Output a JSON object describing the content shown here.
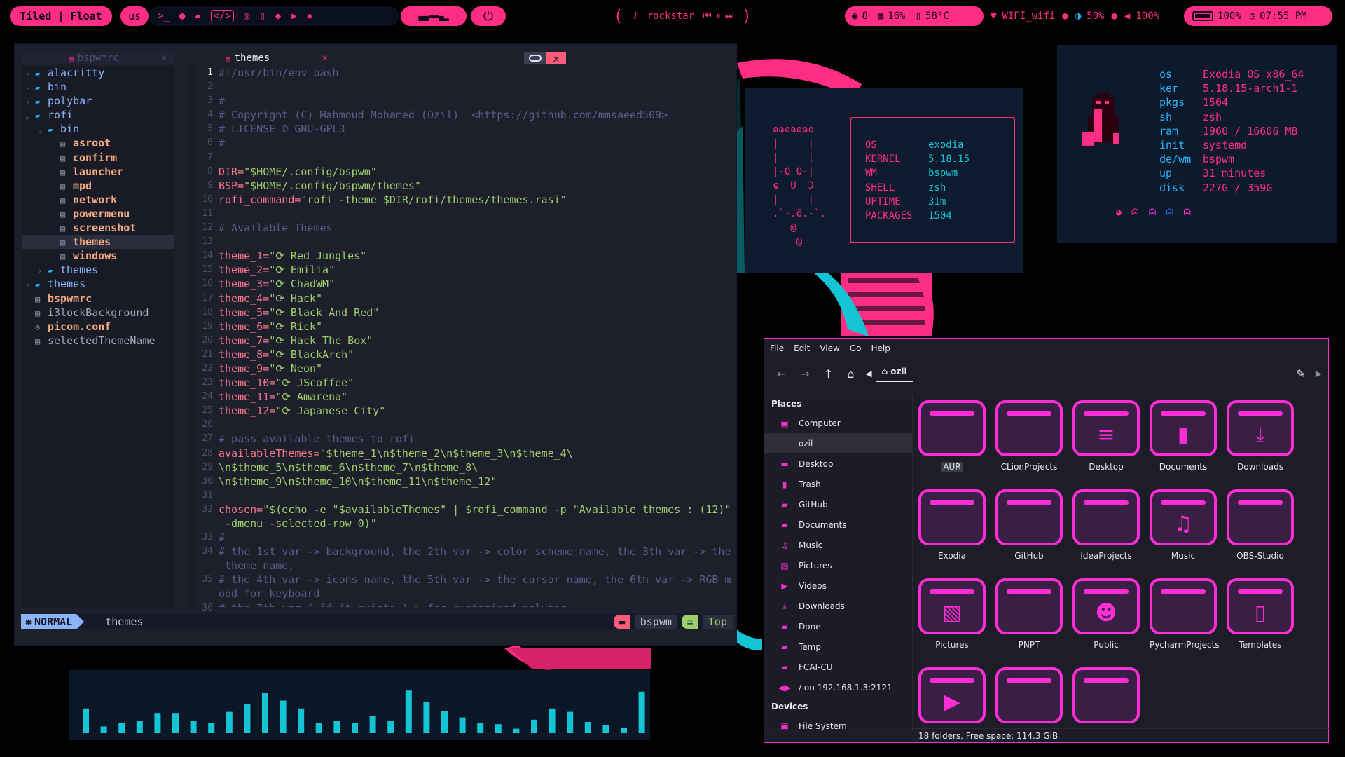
{
  "topbar": {
    "layout": "Tiled | Float",
    "keyboard": "us",
    "workspaces_glyph": "▄▄▬▬▄▂",
    "media_note": "♪",
    "media_title": "rockstar",
    "updates": "8",
    "cpu": "16%",
    "temp": "58°C",
    "wifi": "WIFI_wifi",
    "brightness": "50%",
    "volume": "100%",
    "battery": "100%",
    "time": "07:55 PM"
  },
  "editor": {
    "inactive_tab": "bspwmrc",
    "active_tab": "themes",
    "tree": [
      {
        "d": 0,
        "t": "alacritty",
        "k": "dir"
      },
      {
        "d": 0,
        "t": "bin",
        "k": "dir"
      },
      {
        "d": 0,
        "t": "polybar",
        "k": "dir"
      },
      {
        "d": 0,
        "t": "rofi",
        "k": "dir-open"
      },
      {
        "d": 1,
        "t": "bin",
        "k": "dir-open"
      },
      {
        "d": 2,
        "t": "asroot",
        "k": "file"
      },
      {
        "d": 2,
        "t": "confirm",
        "k": "file"
      },
      {
        "d": 2,
        "t": "launcher",
        "k": "file"
      },
      {
        "d": 2,
        "t": "mpd",
        "k": "file"
      },
      {
        "d": 2,
        "t": "network",
        "k": "file"
      },
      {
        "d": 2,
        "t": "powermenu",
        "k": "file"
      },
      {
        "d": 2,
        "t": "screenshot",
        "k": "file"
      },
      {
        "d": 2,
        "t": "themes",
        "k": "file-sel"
      },
      {
        "d": 2,
        "t": "windows",
        "k": "file"
      },
      {
        "d": 1,
        "t": "themes",
        "k": "dir"
      },
      {
        "d": 0,
        "t": "themes",
        "k": "dir"
      },
      {
        "d": 0,
        "t": "bspwmrc",
        "k": "file-hl"
      },
      {
        "d": 0,
        "t": "i3lockBackground",
        "k": "file-plain"
      },
      {
        "d": 0,
        "t": "picom.conf",
        "k": "gear"
      },
      {
        "d": 0,
        "t": "selectedThemeName",
        "k": "file-plain"
      }
    ],
    "lines": [
      {
        "n": "1",
        "t": "#!/usr/bin/env bash",
        "c": "cm"
      },
      {
        "n": "2",
        "t": "",
        "c": "cm"
      },
      {
        "n": "3",
        "t": "#",
        "c": "cm"
      },
      {
        "n": "4",
        "t": "# Copyright (C) Mahmoud Mohamed (Ozil)  <https://github.com/mmsaeed509>",
        "c": "cm"
      },
      {
        "n": "5",
        "t": "# LICENSE © GNU-GPL3",
        "c": "cm"
      },
      {
        "n": "6",
        "t": "#",
        "c": "cm"
      },
      {
        "n": "7",
        "t": "",
        "c": "cm"
      },
      {
        "n": "8",
        "t": "DIR=\"$HOME/.config/bspwm\"",
        "c": "as"
      },
      {
        "n": "9",
        "t": "BSP=\"$HOME/.config/bspwm/themes\"",
        "c": "as"
      },
      {
        "n": "10",
        "t": "rofi_command=\"rofi -theme $DIR/rofi/themes/themes.rasi\"",
        "c": "as"
      },
      {
        "n": "11",
        "t": "",
        "c": "cm"
      },
      {
        "n": "12",
        "t": "# Available Themes",
        "c": "cm"
      },
      {
        "n": "13",
        "t": "",
        "c": "cm"
      },
      {
        "n": "14",
        "t": "theme_1=\"⟳ Red Jungles\"",
        "c": "as"
      },
      {
        "n": "15",
        "t": "theme_2=\"⟳ Emilia\"",
        "c": "as"
      },
      {
        "n": "16",
        "t": "theme_3=\"⟳ ChadWM\"",
        "c": "as"
      },
      {
        "n": "17",
        "t": "theme_4=\"⟳ Hack\"",
        "c": "as"
      },
      {
        "n": "18",
        "t": "theme_5=\"⟳ Black And Red\"",
        "c": "as"
      },
      {
        "n": "19",
        "t": "theme_6=\"⟳ Rick\"",
        "c": "as"
      },
      {
        "n": "20",
        "t": "theme_7=\"⟳ Hack The Box\"",
        "c": "as"
      },
      {
        "n": "21",
        "t": "theme_8=\"⟳ BlackArch\"",
        "c": "as"
      },
      {
        "n": "22",
        "t": "theme_9=\"⟳ Neon\"",
        "c": "as"
      },
      {
        "n": "23",
        "t": "theme_10=\"⟳ JScoffee\"",
        "c": "as"
      },
      {
        "n": "24",
        "t": "theme_11=\"⟳ Amarena\"",
        "c": "as"
      },
      {
        "n": "25",
        "t": "theme_12=\"⟳ Japanese City\"",
        "c": "as"
      },
      {
        "n": "26",
        "t": "",
        "c": "cm"
      },
      {
        "n": "27",
        "t": "# pass available themes to rofi",
        "c": "cm"
      },
      {
        "n": "28",
        "t": "availableThemes=\"$theme_1\\n$theme_2\\n$theme_3\\n$theme_4\\",
        "c": "as"
      },
      {
        "n": "29",
        "t": "\\n$theme_5\\n$theme_6\\n$theme_7\\n$theme_8\\",
        "c": "as"
      },
      {
        "n": "30",
        "t": "\\n$theme_9\\n$theme_10\\n$theme_11\\n$theme_12\"",
        "c": "as"
      },
      {
        "n": "31",
        "t": "",
        "c": "cm"
      },
      {
        "n": "32",
        "t": "chosen=\"$(echo -e \"$availableThemes\" | $rofi_command -p \"Available themes : (12)\"",
        "c": "as"
      },
      {
        "n": "",
        "t": " -dmenu -selected-row 0)\"",
        "c": "as"
      },
      {
        "n": "33",
        "t": "#",
        "c": "cm"
      },
      {
        "n": "34",
        "t": "# the 1st var -> background, the 2th var -> color scheme name, the 3th var -> the",
        "c": "cm"
      },
      {
        "n": "",
        "t": " theme name,",
        "c": "cm"
      },
      {
        "n": "35",
        "t": "# the 4th var -> icons name, the 5th var -> the cursor name, the 6th var -> RGB m",
        "c": "cm"
      },
      {
        "n": "",
        "t": "ood for keyboard",
        "c": "cm"
      },
      {
        "n": "36",
        "t": "# the 7th var ( if it exists )-> for customized polybar",
        "c": "cm"
      }
    ],
    "status": {
      "mode": "NORMAL",
      "file": "themes",
      "ft": "bspwm",
      "pos": "Top"
    }
  },
  "fetch1": {
    "keys": [
      "OS",
      "KERNEL",
      "WM",
      "SHELL",
      "UPTIME",
      "PACKAGES"
    ],
    "values": [
      "exodia",
      "5.18.15",
      "bspwm",
      "zsh",
      "31m",
      "1504"
    ],
    "art": [
      "ɷɷɷɷɷɷɷ",
      "|     |",
      "|     |",
      "|-O O-|",
      "ɕ  U  Ɔ",
      "|     |",
      ".`-.ö.-`.",
      "   @",
      "    @"
    ]
  },
  "fetch2": {
    "keys": [
      "os",
      "ker",
      "pkgs",
      "sh",
      "ram",
      "init",
      "de/wm",
      "up",
      "disk"
    ],
    "values": [
      "Exodia OS x86_64",
      "5.18.15-arch1-1",
      "1504",
      "zsh",
      "1960 / 16606 MB",
      "systemd",
      "bspwm",
      "31 minutes",
      "227G / 359G"
    ]
  },
  "visualizer": {
    "levels": [
      0.44,
      0.12,
      0.18,
      0.22,
      0.36,
      0.36,
      0.22,
      0.18,
      0.38,
      0.52,
      0.72,
      0.58,
      0.44,
      0.18,
      0.22,
      0.18,
      0.3,
      0.22,
      0.76,
      0.56,
      0.4,
      0.28,
      0.18,
      0.16,
      0.08,
      0.24,
      0.44,
      0.38,
      0.2,
      0.14,
      0.1,
      0.74
    ]
  },
  "fm": {
    "menu": [
      "File",
      "Edit",
      "View",
      "Go",
      "Help"
    ],
    "location": "ozil",
    "places_title": "Places",
    "places": [
      "Computer",
      "ozil",
      "Desktop",
      "Trash",
      "GitHub",
      "Documents",
      "Music",
      "Pictures",
      "Videos",
      "Downloads",
      "Done",
      "Temp",
      "FCAI-CU",
      "/ on 192.168.1.3:2121"
    ],
    "devices_title": "Devices",
    "devices": [
      "File System"
    ],
    "items": [
      "AUR",
      "CLionProjects",
      "Desktop",
      "Documents",
      "Downloads",
      "Exodia",
      "GitHub",
      "IdeaProjects",
      "Music",
      "OBS-Studio",
      "Pictures",
      "PNPT",
      "Public",
      "PycharmProjects",
      "Templates",
      "",
      "",
      ""
    ],
    "statusbar": "18 folders, Free space: 114.3 GiB"
  },
  "colors": {
    "accent": "#ff2d84",
    "magenta": "#ff2dd6",
    "cyan": "#12c4d4",
    "blue": "#2ab2ff"
  }
}
